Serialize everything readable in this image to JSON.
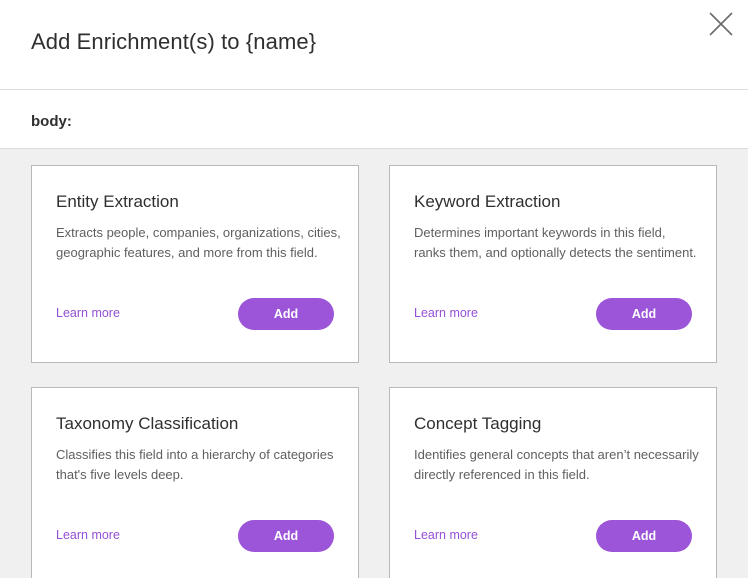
{
  "dialog": {
    "title": "Add Enrichment(s) to {name}",
    "close_icon": "close-icon"
  },
  "field": {
    "label": "body:"
  },
  "colors": {
    "accent": "#9c55d9",
    "link": "#9450d6"
  },
  "cards": [
    {
      "title": "Entity Extraction",
      "description": "Extracts people, companies, organizations, cities, geographic features, and more from this field.",
      "learn_more": "Learn more",
      "add_label": "Add"
    },
    {
      "title": "Keyword Extraction",
      "description": "Determines important keywords in this field, ranks them, and optionally detects the sentiment.",
      "learn_more": "Learn more",
      "add_label": "Add"
    },
    {
      "title": "Taxonomy Classification",
      "description": "Classifies this field into a hierarchy of categories that's five levels deep.",
      "learn_more": "Learn more",
      "add_label": "Add"
    },
    {
      "title": "Concept Tagging",
      "description": "Identifies general concepts that aren’t necessarily directly referenced in this field.",
      "learn_more": "Learn more",
      "add_label": "Add"
    }
  ]
}
